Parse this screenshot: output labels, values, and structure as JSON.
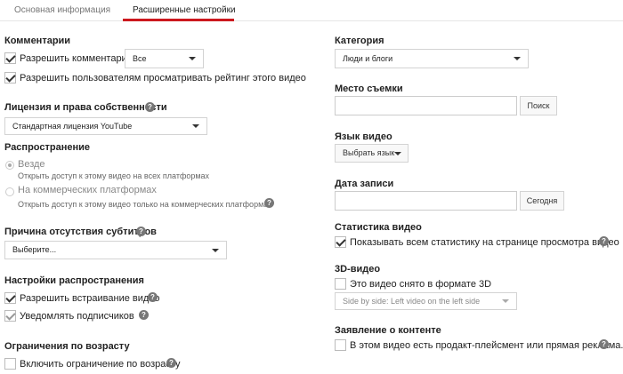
{
  "tabs": {
    "basic": "Основная информация",
    "advanced": "Расширенные настройки"
  },
  "left": {
    "comments": {
      "heading": "Комментарии",
      "allow_label": "Разрешить комментарии",
      "allow_select_value": "Все",
      "ratings_label": "Разрешить пользователям просматривать рейтинг этого видео"
    },
    "license": {
      "heading": "Лицензия и права собственности",
      "select_value": "Стандартная лицензия YouTube"
    },
    "distribution": {
      "heading": "Распространение",
      "everywhere_label": "Везде",
      "everywhere_hint": "Открыть доступ к этому видео на всех платформах",
      "commercial_label": "На коммерческих платформах",
      "commercial_hint": "Открыть доступ к этому видео только на коммерческих платформах"
    },
    "captions": {
      "heading": "Причина отсутствия субтитров",
      "select_value": "Выберите..."
    },
    "distribution_settings": {
      "heading": "Настройки распространения",
      "embed_label": "Разрешить встраивание видео",
      "notify_label": "Уведомлять подписчиков"
    },
    "age": {
      "heading": "Ограничения по возрасту",
      "restrict_label": "Включить ограничение по возрасту"
    }
  },
  "right": {
    "category": {
      "heading": "Категория",
      "select_value": "Люди и блоги"
    },
    "location": {
      "heading": "Место съемки",
      "input_value": "",
      "search_button": "Поиск"
    },
    "language": {
      "heading": "Язык видео",
      "button": "Выбрать язык"
    },
    "recording_date": {
      "heading": "Дата записи",
      "input_value": "",
      "today_button": "Сегодня"
    },
    "stats": {
      "heading": "Статистика видео",
      "show_label": "Показывать всем статистику на странице просмотра видео"
    },
    "video3d": {
      "heading": "3D-видео",
      "is3d_label": "Это видео снято в формате 3D",
      "select_value": "Side by side: Left video on the left side"
    },
    "content_declaration": {
      "heading": "Заявление о контенте",
      "label": "В этом видео есть продакт-плейсмент или прямая реклама."
    }
  },
  "help_glyph": "?",
  "colors": {
    "accent": "#cc181e",
    "help_icon": "#777777",
    "border": "#d3d3d3"
  }
}
